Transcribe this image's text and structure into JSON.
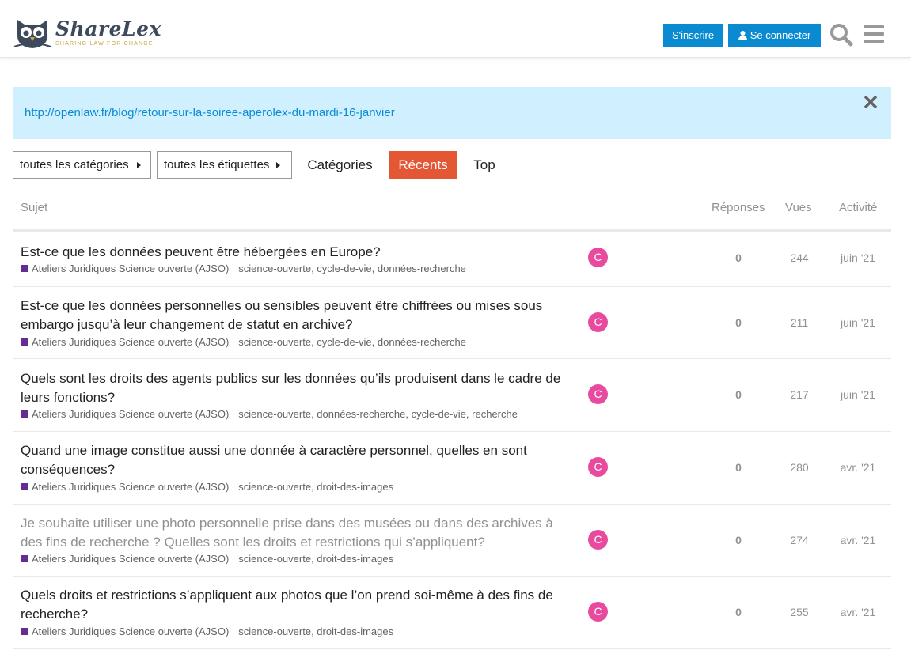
{
  "brand": {
    "name": "ShareLex",
    "tagline": "SHARING LAW FOR CHANGE",
    "logo_color": "#3d4a5c",
    "accent": "#c9a441"
  },
  "header": {
    "signup_label": "S'inscrire",
    "login_label": "Se connecter",
    "primary_color": "#0a8bd1"
  },
  "banner": {
    "link": "http://openlaw.fr/blog/retour-sur-la-soiree-aperolex-du-mardi-16-janvier",
    "background": "#d1f0ff"
  },
  "nav": {
    "categories_dropdown": "toutes les catégories",
    "tags_dropdown": "toutes les étiquettes",
    "tabs": [
      "Catégories",
      "Récents",
      "Top"
    ],
    "active_tab": "Récents",
    "active_color": "#e45735"
  },
  "table": {
    "headers": {
      "subject": "Sujet",
      "replies": "Réponses",
      "views": "Vues",
      "activity": "Activité"
    },
    "category": "Ateliers Juridiques Science ouverte (AJSO)",
    "category_color": "#652d90",
    "avatar_letter": "C",
    "avatar_color": "#e84a9e",
    "rows": [
      {
        "title": "Est-ce que les données peuvent être hébergées en Europe?",
        "tags": [
          "science-ouverte",
          "cycle-de-vie",
          "données-recherche"
        ],
        "replies": "0",
        "views": "244",
        "activity": "juin '21",
        "visited": false
      },
      {
        "title": "Est-ce que les données personnelles ou sensibles peuvent être chiffrées ou mises sous embargo jusqu’à leur changement de statut en archive?",
        "tags": [
          "science-ouverte",
          "cycle-de-vie",
          "données-recherche"
        ],
        "replies": "0",
        "views": "211",
        "activity": "juin '21",
        "visited": false
      },
      {
        "title": "Quels sont les droits des agents publics sur les données qu’ils produisent dans le cadre de leurs fonctions?",
        "tags": [
          "science-ouverte",
          "données-recherche",
          "cycle-de-vie",
          "recherche"
        ],
        "replies": "0",
        "views": "217",
        "activity": "juin '21",
        "visited": false
      },
      {
        "title": "Quand une image constitue aussi une donnée à caractère personnel, quelles en sont conséquences?",
        "tags": [
          "science-ouverte",
          "droit-des-images"
        ],
        "replies": "0",
        "views": "280",
        "activity": "avr. '21",
        "visited": false
      },
      {
        "title": "Je souhaite utiliser une photo personnelle prise dans des musées ou dans des archives à des fins de recherche ? Quelles sont les droits et restrictions qui s’appliquent?",
        "tags": [
          "science-ouverte",
          "droit-des-images"
        ],
        "replies": "0",
        "views": "274",
        "activity": "avr. '21",
        "visited": true
      },
      {
        "title": "Quels droits et restrictions s’appliquent aux photos que l’on prend soi-même à des fins de recherche?",
        "tags": [
          "science-ouverte",
          "droit-des-images"
        ],
        "replies": "0",
        "views": "255",
        "activity": "avr. '21",
        "visited": false
      }
    ]
  }
}
